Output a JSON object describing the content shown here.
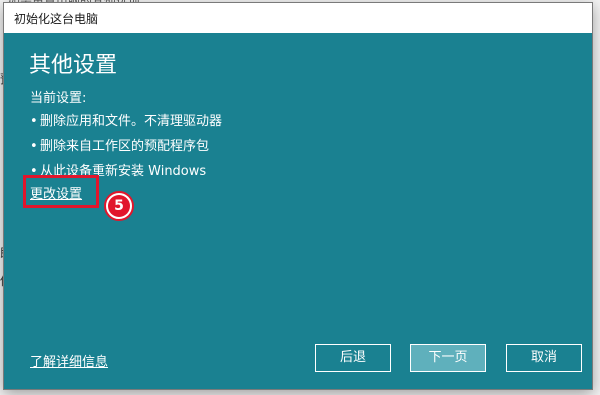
{
  "background": {
    "top_text": "如需重置电脑的其他选项",
    "side_texts": [
      "预",
      "即",
      "供"
    ]
  },
  "dialog": {
    "title": "初始化这台电脑",
    "heading": "其他设置",
    "current_label": "当前设置:",
    "bullets": [
      "删除应用和文件。不清理驱动器",
      "删除来自工作区的预配程序包",
      "从此设备重新安装 Windows"
    ],
    "change_settings_link": "更改设置",
    "step_marker": "5",
    "learn_more_link": "了解详细信息",
    "buttons": {
      "back": "后退",
      "next": "下一页",
      "cancel": "取消"
    }
  },
  "colors": {
    "dialog_bg": "#1a8191",
    "highlight": "#e1162c",
    "next_button_bg": "#5fb0bc"
  }
}
